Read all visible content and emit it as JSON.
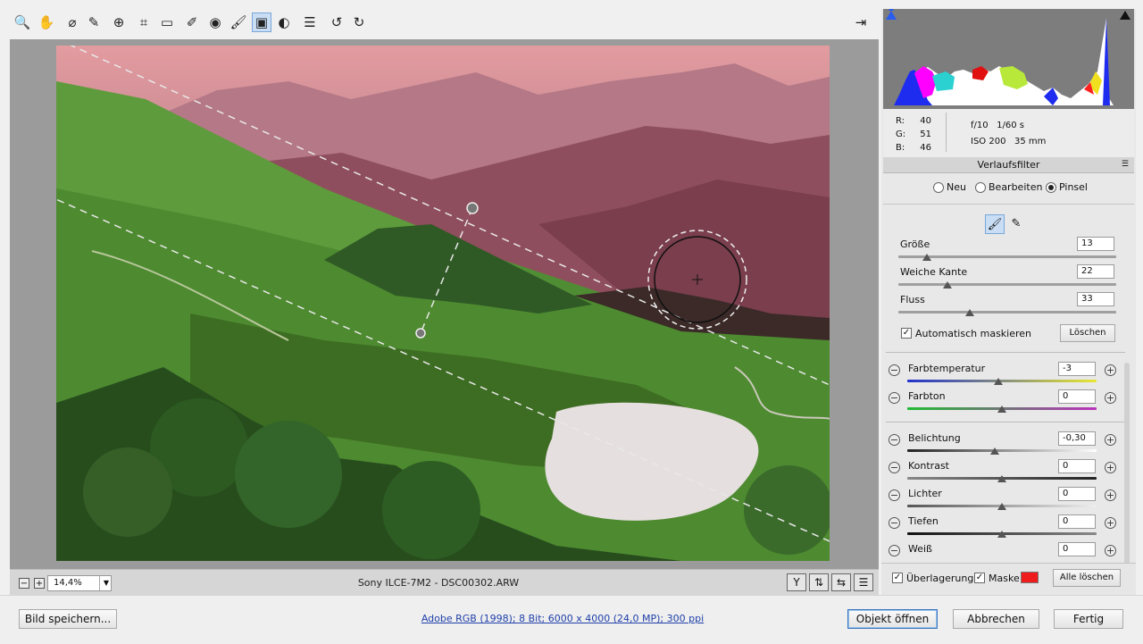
{
  "toolbar": {
    "tools": [
      {
        "name": "zoom-tool",
        "glyph": "🔍"
      },
      {
        "name": "hand-tool",
        "glyph": "✋"
      },
      {
        "name": "white-balance-tool",
        "glyph": "⌀"
      },
      {
        "name": "color-sampler-tool",
        "glyph": "✎"
      },
      {
        "name": "targeted-adjustment-tool",
        "glyph": "⊕"
      },
      {
        "name": "crop-tool",
        "glyph": "⌗"
      },
      {
        "name": "straighten-tool",
        "glyph": "▭"
      },
      {
        "name": "spot-removal-tool",
        "glyph": "✐"
      },
      {
        "name": "red-eye-tool",
        "glyph": "◉"
      },
      {
        "name": "adjustment-brush-tool",
        "glyph": "🖌"
      },
      {
        "name": "graduated-filter-tool",
        "glyph": "▣"
      },
      {
        "name": "radial-filter-tool",
        "glyph": "◐"
      },
      {
        "name": "preferences-tool",
        "glyph": "☰"
      },
      {
        "name": "rotate-left-tool",
        "glyph": "↺"
      },
      {
        "name": "rotate-right-tool",
        "glyph": "↻"
      }
    ],
    "fullscreen_glyph": "⇥"
  },
  "statusbar": {
    "zoom_out": "−",
    "zoom_in": "+",
    "zoom_value": "14,4%",
    "filename": "Sony ILCE-7M2 - DSC00302.ARW",
    "view_buttons": [
      "Y",
      "⇅",
      "⇆",
      "☰"
    ]
  },
  "readout": {
    "r_label": "R:",
    "r_value": "40",
    "g_label": "G:",
    "g_value": "51",
    "b_label": "B:",
    "b_value": "46",
    "aperture": "f/10",
    "shutter": "1/60 s",
    "iso": "ISO 200",
    "focal": "35 mm"
  },
  "panel": {
    "title": "Verlaufsfilter",
    "mode_new": "Neu",
    "mode_edit": "Bearbeiten",
    "mode_brush": "Pinsel",
    "size_label": "Größe",
    "size_value": "13",
    "feather_label": "Weiche Kante",
    "feather_value": "22",
    "flow_label": "Fluss",
    "flow_value": "33",
    "automask_label": "Automatisch maskieren",
    "clear_label": "Löschen",
    "temp_label": "Farbtemperatur",
    "temp_value": "-3",
    "tint_label": "Farbton",
    "tint_value": "0",
    "exposure_label": "Belichtung",
    "exposure_value": "-0,30",
    "contrast_label": "Kontrast",
    "contrast_value": "0",
    "highlights_label": "Lichter",
    "highlights_value": "0",
    "shadows_label": "Tiefen",
    "shadows_value": "0",
    "whites_label": "Weiß",
    "whites_value": "0",
    "overlay_label": "Überlagerung",
    "mask_label": "Maske",
    "mask_color": "#ee1c1c",
    "clear_all_label": "Alle löschen"
  },
  "bottom": {
    "save_label": "Bild speichern...",
    "info_link": "Adobe RGB (1998); 8 Bit; 6000 x 4000 (24,0 MP); 300 ppi",
    "open_label": "Objekt öffnen",
    "cancel_label": "Abbrechen",
    "done_label": "Fertig"
  }
}
